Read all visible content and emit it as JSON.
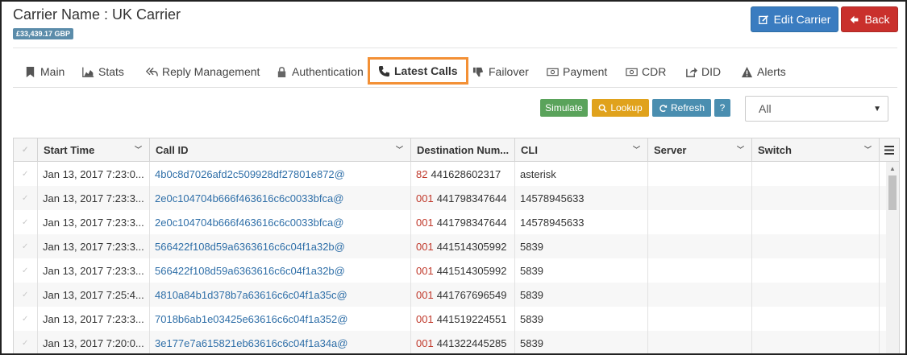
{
  "header": {
    "title": "Carrier Name : UK Carrier",
    "balance": "£33,439.17 GBP",
    "edit_label": "Edit Carrier",
    "back_label": "Back"
  },
  "tabs": [
    {
      "label": "Main",
      "icon": "bookmark-icon"
    },
    {
      "label": "Stats",
      "icon": "area-chart-icon"
    },
    {
      "label": "Reply Management",
      "icon": "reply-all-icon"
    },
    {
      "label": "Authentication",
      "icon": "lock-icon"
    },
    {
      "label": "Latest Calls",
      "icon": "phone-icon",
      "active": true
    },
    {
      "label": "Failover",
      "icon": "thumbs-down-icon"
    },
    {
      "label": "Payment",
      "icon": "money-icon"
    },
    {
      "label": "CDR",
      "icon": "money-icon"
    },
    {
      "label": "DID",
      "icon": "share-icon"
    },
    {
      "label": "Alerts",
      "icon": "warning-icon"
    }
  ],
  "toolbar": {
    "simulate": "Simulate",
    "lookup": "Lookup",
    "refresh": "Refresh",
    "help": "?",
    "filter_value": "All"
  },
  "grid": {
    "columns": [
      "Start Time",
      "Call ID",
      "Destination Num...",
      "CLI",
      "Server",
      "Switch"
    ],
    "rows": [
      {
        "start": "Jan 13, 2017 7:23:0...",
        "callid": "4b0c8d7026afd2c509928df27801e872@",
        "prefix": "82",
        "dest": "441628602317",
        "cli": "asterisk"
      },
      {
        "start": "Jan 13, 2017 7:23:3...",
        "callid": "2e0c104704b666f463616c6c0033bfca@",
        "prefix": "001",
        "dest": "441798347644",
        "cli": "14578945633"
      },
      {
        "start": "Jan 13, 2017 7:23:3...",
        "callid": "2e0c104704b666f463616c6c0033bfca@",
        "prefix": "001",
        "dest": "441798347644",
        "cli": "14578945633"
      },
      {
        "start": "Jan 13, 2017 7:23:3...",
        "callid": "566422f108d59a6363616c6c04f1a32b@",
        "prefix": "001",
        "dest": "441514305992",
        "cli": "5839"
      },
      {
        "start": "Jan 13, 2017 7:23:3...",
        "callid": "566422f108d59a6363616c6c04f1a32b@",
        "prefix": "001",
        "dest": "441514305992",
        "cli": "5839"
      },
      {
        "start": "Jan 13, 2017 7:25:4...",
        "callid": "4810a84b1d378b7a63616c6c04f1a35c@",
        "prefix": "001",
        "dest": "441767696549",
        "cli": "5839"
      },
      {
        "start": "Jan 13, 2017 7:23:3...",
        "callid": "7018b6ab1e03425e63616c6c04f1a352@",
        "prefix": "001",
        "dest": "441519224551",
        "cli": "5839"
      },
      {
        "start": "Jan 13, 2017 7:20:0...",
        "callid": "3e177e7a615821eb63616c6c04f1a34a@",
        "prefix": "001",
        "dest": "441322445285",
        "cli": "5839"
      }
    ]
  }
}
